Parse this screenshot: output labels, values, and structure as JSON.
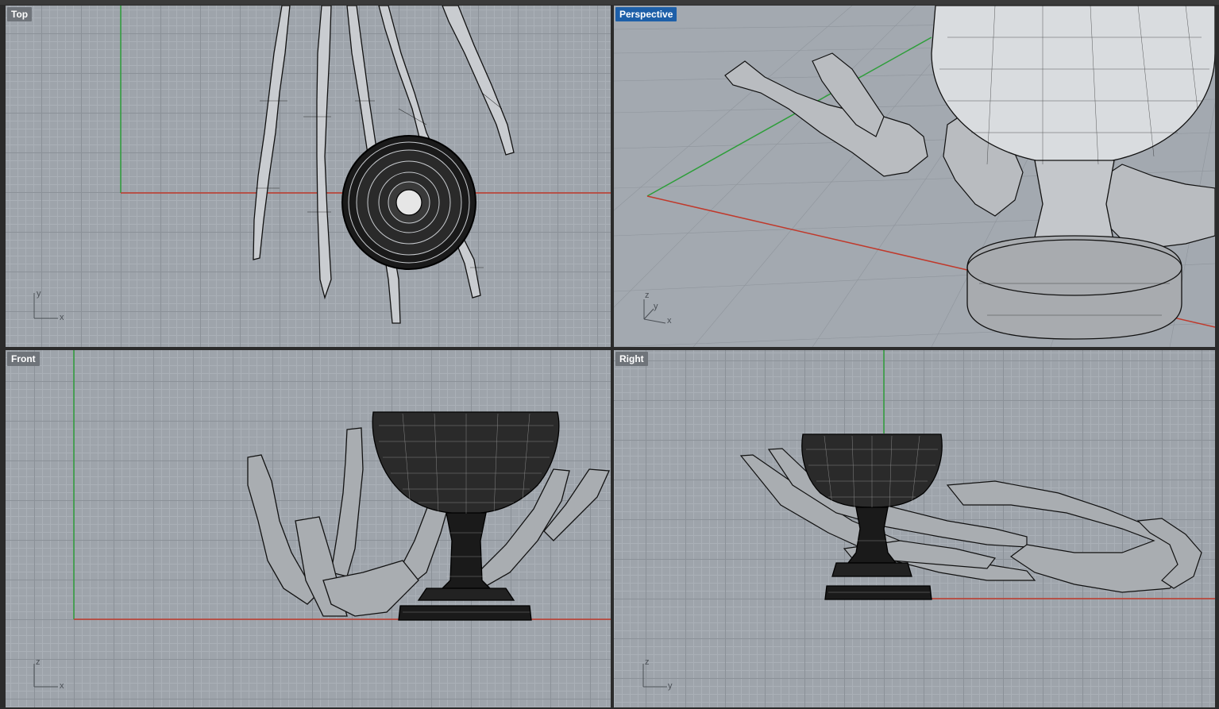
{
  "viewports": {
    "top": {
      "label": "Top",
      "axes": [
        "y",
        "x"
      ],
      "active": false
    },
    "perspective": {
      "label": "Perspective",
      "axes": [
        "z",
        "y",
        "x"
      ],
      "active": true
    },
    "front": {
      "label": "Front",
      "axes": [
        "z",
        "x"
      ],
      "active": false
    },
    "right": {
      "label": "Right",
      "axes": [
        "z",
        "y"
      ],
      "active": false
    }
  },
  "colors": {
    "x_axis": "#c0392b",
    "y_axis": "#2e9e3a",
    "active_label": "#1d5fa8",
    "inactive_label": "#6f747a",
    "grid_bg": "#9ea4ab"
  },
  "model": {
    "description_icons": [
      "skeleton-hand-icon",
      "goblet-icon"
    ]
  }
}
